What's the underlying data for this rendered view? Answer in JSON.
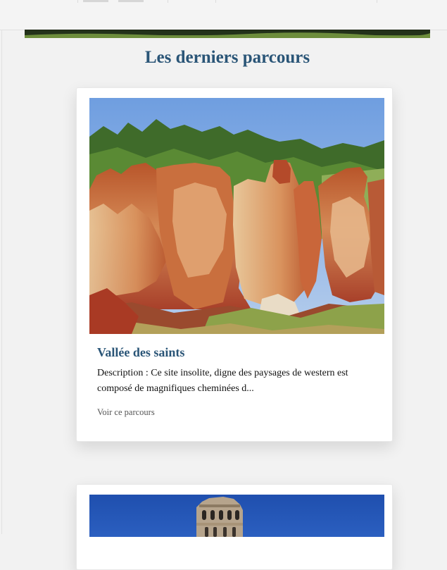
{
  "section": {
    "title": "Les derniers parcours"
  },
  "cards": [
    {
      "title": "Vallée des saints",
      "description": "Description : Ce site insolite, digne des paysages de western est composé de magnifiques cheminées d...",
      "link": "Voir ce parcours",
      "image": "red-rock-formations-photo"
    },
    {
      "image": "church-bell-tower-photo"
    }
  ],
  "colors": {
    "heading": "#2a5577",
    "page_bg": "#f2f2f2",
    "card_bg": "#ffffff"
  }
}
